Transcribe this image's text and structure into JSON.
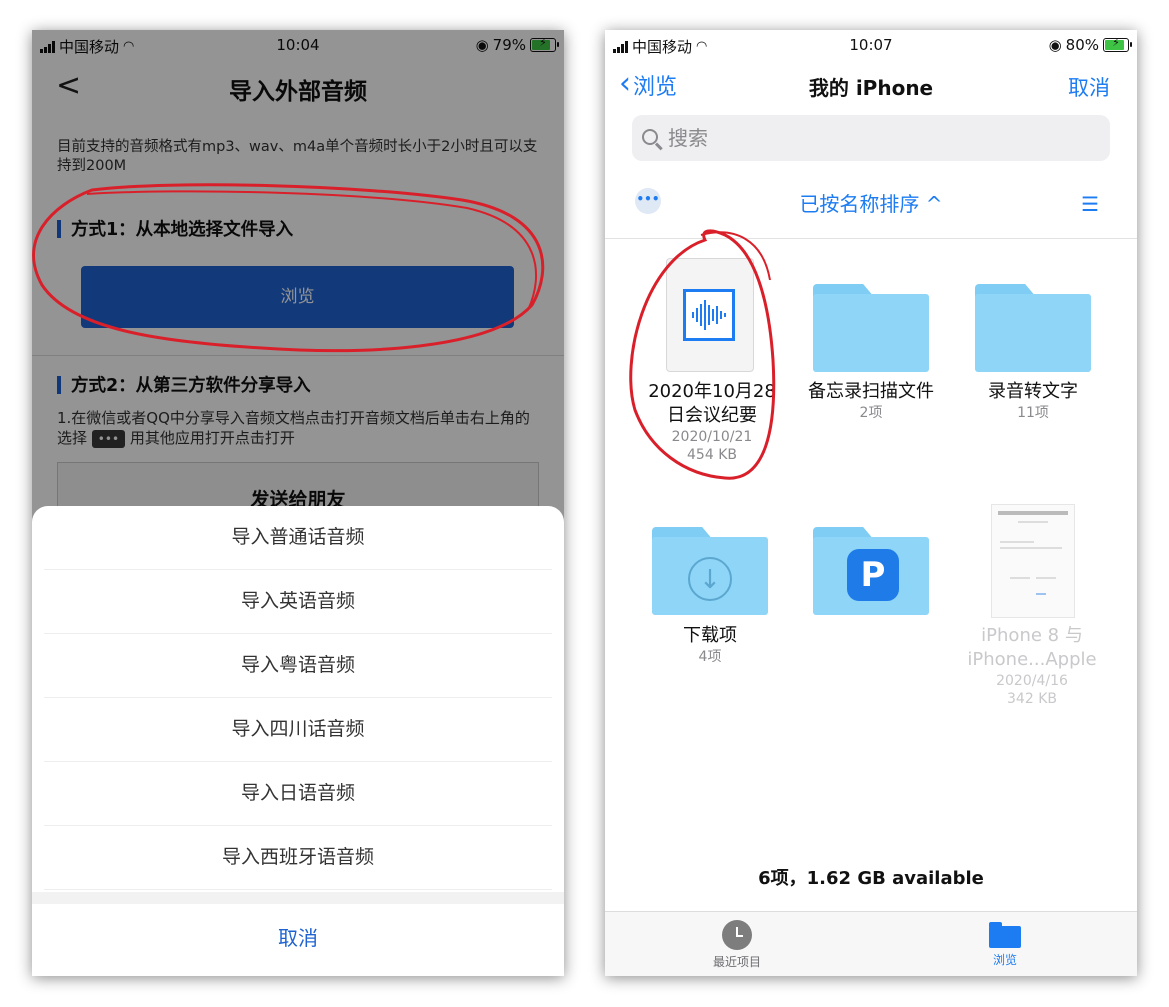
{
  "left": {
    "status": {
      "carrier": "中国移动",
      "time": "10:04",
      "battery": "79%"
    },
    "nav": {
      "back": "<",
      "title": "导入外部音频"
    },
    "description": "目前支持的音频格式有mp3、wav、m4a单个音频时长小于2小时且可以支持到200M",
    "method1": {
      "title": "方式1：从本地选择文件导入",
      "button": "浏览"
    },
    "method2": {
      "title": "方式2：从第三方软件分享导入",
      "step_pre": "1.在微信或者QQ中分享导入音频文档点击打开音频文档后单击右上角的选择",
      "dots": "•••",
      "step_post": "用其他应用打开点击打开",
      "card_title": "发送给朋友"
    },
    "sheet": {
      "options": [
        "导入普通话音频",
        "导入英语音频",
        "导入粤语音频",
        "导入四川话音频",
        "导入日语音频",
        "导入西班牙语音频"
      ],
      "cancel": "取消"
    }
  },
  "right": {
    "status": {
      "carrier": "中国移动",
      "time": "10:07",
      "battery": "80%"
    },
    "nav": {
      "back": "浏览",
      "title": "我的 iPhone",
      "cancel": "取消"
    },
    "search": {
      "placeholder": "搜索"
    },
    "sort_label": "已按名称排序 ^",
    "items": [
      {
        "name_line1": "2020年10月28",
        "name_line2": "日会议纪要",
        "date": "2020/10/21",
        "size": "454 KB"
      },
      {
        "name": "备忘录扫描文件",
        "meta": "2项"
      },
      {
        "name": "录音转文字",
        "meta": "11项"
      },
      {
        "name": "下载项",
        "meta": "4项"
      },
      {
        "name": "",
        "meta": ""
      },
      {
        "name_line1": "iPhone 8 与",
        "name_line2": "iPhone...Apple",
        "date": "2020/4/16",
        "size": "342 KB"
      }
    ],
    "footer": "6项，1.62 GB available",
    "tabs": [
      {
        "label": "最近项目"
      },
      {
        "label": "浏览"
      }
    ]
  },
  "colors": {
    "accent": "#1d7cf2",
    "button": "#1f64d4",
    "annotation": "#d9202a"
  }
}
